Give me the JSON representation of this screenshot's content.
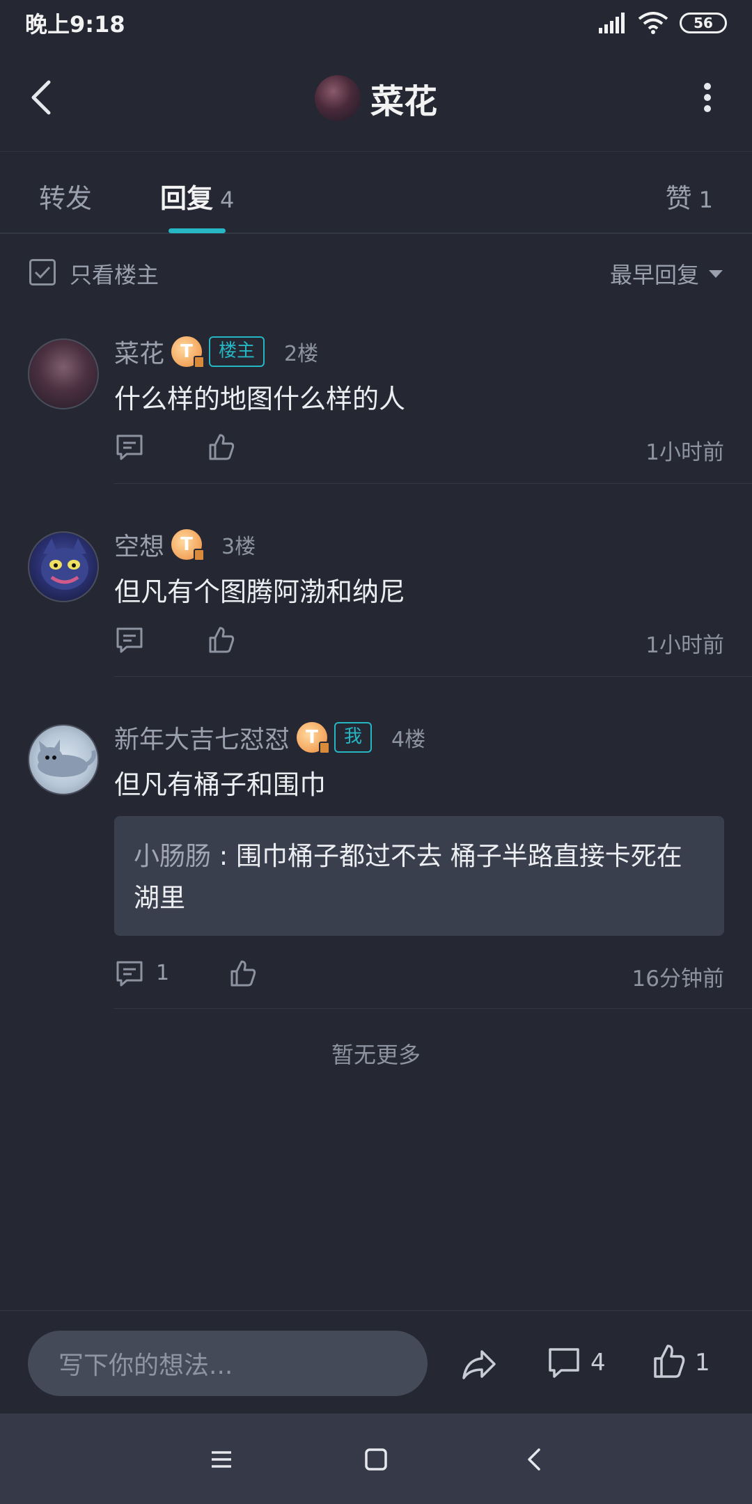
{
  "status": {
    "time": "晚上9:18",
    "battery": "56"
  },
  "nav": {
    "title": "菜花"
  },
  "tabs": {
    "forward": "转发",
    "reply": "回复",
    "reply_count": "4",
    "like": "赞",
    "like_count": "1"
  },
  "filter": {
    "only_op_label": "只看楼主",
    "sort_label": "最早回复"
  },
  "replies": [
    {
      "username": "菜花",
      "level": "T",
      "tag": "楼主",
      "floor": "2楼",
      "text": "什么样的地图什么样的人",
      "time": "1小时前",
      "comment_count": ""
    },
    {
      "username": "空想",
      "level": "T",
      "tag": "",
      "floor": "3楼",
      "text": "但凡有个图腾阿渤和纳尼",
      "time": "1小时前",
      "comment_count": ""
    },
    {
      "username": "新年大吉七怼怼",
      "level": "T",
      "tag": "我",
      "floor": "4楼",
      "text": "但凡有桶子和围巾",
      "time": "16分钟前",
      "comment_count": "1",
      "sub_reply": {
        "author": "小肠肠",
        "separator": " : ",
        "text": "围巾桶子都过不去 桶子半路直接卡死在湖里"
      }
    }
  ],
  "no_more": "暂无更多",
  "bottom": {
    "placeholder": "写下你的想法...",
    "comment_count": "4",
    "like_count": "1"
  },
  "colors": {
    "background": "#252833",
    "accent": "#25b7c4",
    "badge": "#f3a35a"
  }
}
